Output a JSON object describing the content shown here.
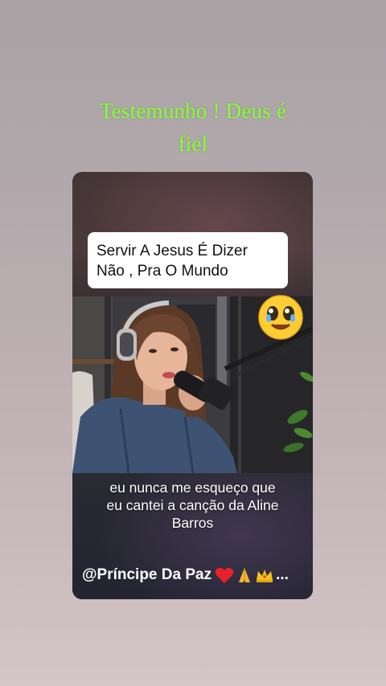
{
  "story": {
    "title_line1": "Testemunho ! Deus é",
    "title_line2": "fiel"
  },
  "video": {
    "caption_line1": "Servir A Jesus É Dizer",
    "caption_line2": "Não , Pra O Mundo",
    "subtitle_line1": "eu nunca me esqueço que",
    "subtitle_line2": "eu cantei a canção da Aline",
    "subtitle_line3": "Barros",
    "username": "@Príncipe Da Paz",
    "username_suffix": "...",
    "emoji_icon": "crying-smile-emoji-icon",
    "username_icons": [
      "red-heart-icon",
      "praying-hands-icon",
      "crown-icon"
    ]
  },
  "colors": {
    "title": "#8cff3c",
    "background_top": "#a9a3a6",
    "background_bottom": "#d4c5c6"
  }
}
